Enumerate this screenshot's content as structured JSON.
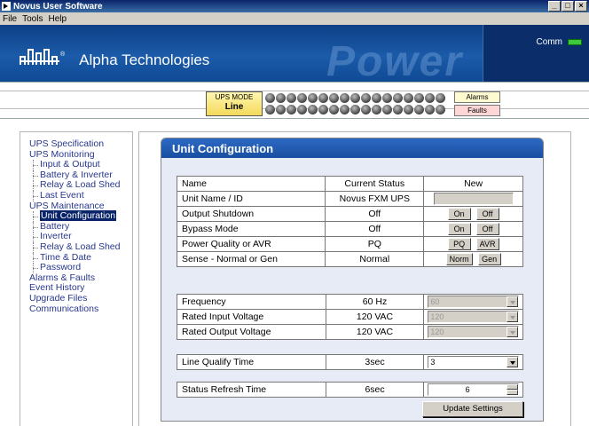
{
  "window": {
    "title": "Novus User Software"
  },
  "menu": [
    "File",
    "Tools",
    "Help"
  ],
  "banner": {
    "company": "Alpha Technologies",
    "watermark": "Power",
    "comm_label": "Comm",
    "comm_color": "#3ec83e"
  },
  "status": {
    "ups_mode_label": "UPS MODE",
    "ups_mode_value": "Line",
    "alarms": "Alarms",
    "faults": "Faults"
  },
  "sidebar": [
    {
      "label": "UPS Specification",
      "level": 0
    },
    {
      "label": "UPS Monitoring",
      "level": 0
    },
    {
      "label": "Input & Output",
      "level": 1
    },
    {
      "label": "Battery & Inverter",
      "level": 1
    },
    {
      "label": "Relay & Load Shed",
      "level": 1
    },
    {
      "label": "Last Event",
      "level": 1
    },
    {
      "label": "UPS Maintenance",
      "level": 0
    },
    {
      "label": "Unit Configuration",
      "level": 1,
      "active": true
    },
    {
      "label": "Battery",
      "level": 1
    },
    {
      "label": "Inverter",
      "level": 1
    },
    {
      "label": "Relay & Load Shed",
      "level": 1
    },
    {
      "label": "Time & Date",
      "level": 1
    },
    {
      "label": "Password",
      "level": 1
    },
    {
      "label": "Alarms & Faults",
      "level": 0
    },
    {
      "label": "Event History",
      "level": 0
    },
    {
      "label": "Upgrade Files",
      "level": 0
    },
    {
      "label": "Communications",
      "level": 0
    }
  ],
  "config": {
    "title": "Unit Configuration",
    "headers": {
      "name": "Name",
      "status": "Current Status",
      "new": "New"
    },
    "rows": {
      "unit_name": {
        "name": "Unit Name / ID",
        "status": "Novus FXM UPS"
      },
      "output_shutdown": {
        "name": "Output Shutdown",
        "status": "Off",
        "btn1": "On",
        "btn2": "Off"
      },
      "bypass": {
        "name": "Bypass Mode",
        "status": "Off",
        "btn1": "On",
        "btn2": "Off"
      },
      "power_quality": {
        "name": "Power Quality or AVR",
        "status": "PQ",
        "btn1": "PQ",
        "btn2": "AVR"
      },
      "sense": {
        "name": "Sense - Normal or Gen",
        "status": "Normal",
        "btn1": "Norm",
        "btn2": "Gen"
      },
      "frequency": {
        "name": "Frequency",
        "status": "60 Hz",
        "new_value": "60"
      },
      "rated_input": {
        "name": "Rated Input Voltage",
        "status": "120 VAC",
        "new_value": "120"
      },
      "rated_output": {
        "name": "Rated Output Voltage",
        "status": "120 VAC",
        "new_value": "120"
      },
      "line_qualify": {
        "name": "Line Qualify Time",
        "status": "3sec",
        "new_value": "3"
      },
      "status_refresh": {
        "name": "Status Refresh Time",
        "status": "6sec",
        "new_value": "6"
      }
    },
    "update_button": "Update Settings"
  }
}
